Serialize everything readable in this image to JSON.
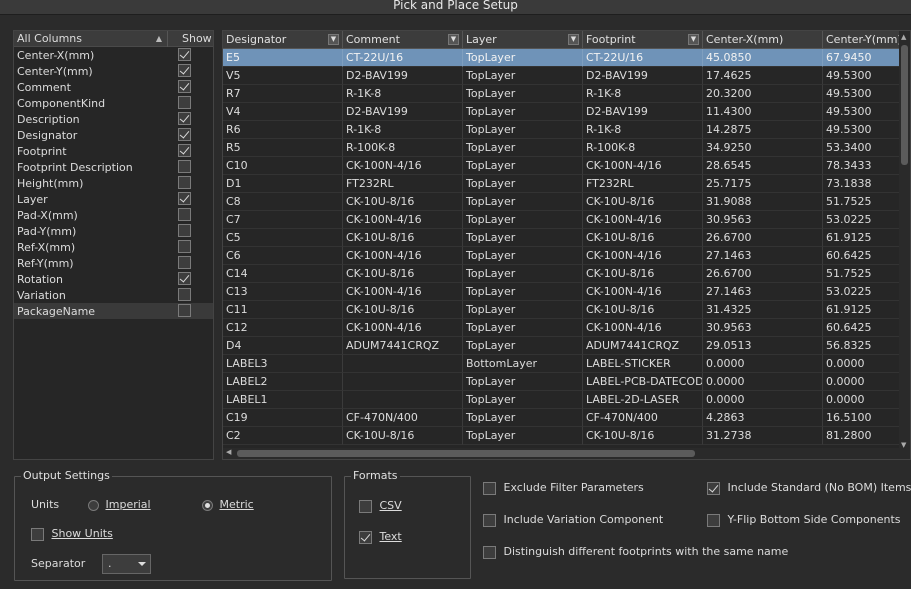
{
  "window": {
    "title": "Pick and Place Setup"
  },
  "columns_panel": {
    "header_label": "All Columns",
    "show_label": "Show",
    "items": [
      {
        "label": "Center-X(mm)",
        "show": true
      },
      {
        "label": "Center-Y(mm)",
        "show": true
      },
      {
        "label": "Comment",
        "show": true
      },
      {
        "label": "ComponentKind",
        "show": false
      },
      {
        "label": "Description",
        "show": true
      },
      {
        "label": "Designator",
        "show": true
      },
      {
        "label": "Footprint",
        "show": true
      },
      {
        "label": "Footprint Description",
        "show": false
      },
      {
        "label": "Height(mm)",
        "show": false
      },
      {
        "label": "Layer",
        "show": true
      },
      {
        "label": "Pad-X(mm)",
        "show": false
      },
      {
        "label": "Pad-Y(mm)",
        "show": false
      },
      {
        "label": "Ref-X(mm)",
        "show": false
      },
      {
        "label": "Ref-Y(mm)",
        "show": false
      },
      {
        "label": "Rotation",
        "show": true
      },
      {
        "label": "Variation",
        "show": false
      },
      {
        "label": "PackageName",
        "show": false
      }
    ]
  },
  "grid": {
    "headers": [
      "Designator",
      "Comment",
      "Layer",
      "Footprint",
      "Center-X(mm)",
      "Center-Y(mm)"
    ],
    "rows": [
      [
        "E5",
        "CT-22U/16",
        "TopLayer",
        "CT-22U/16",
        "45.0850",
        "67.9450"
      ],
      [
        "V5",
        "D2-BAV199",
        "TopLayer",
        "D2-BAV199",
        "17.4625",
        "49.5300"
      ],
      [
        "R7",
        "R-1K-8",
        "TopLayer",
        "R-1K-8",
        "20.3200",
        "49.5300"
      ],
      [
        "V4",
        "D2-BAV199",
        "TopLayer",
        "D2-BAV199",
        "11.4300",
        "49.5300"
      ],
      [
        "R6",
        "R-1K-8",
        "TopLayer",
        "R-1K-8",
        "14.2875",
        "49.5300"
      ],
      [
        "R5",
        "R-100K-8",
        "TopLayer",
        "R-100K-8",
        "34.9250",
        "53.3400"
      ],
      [
        "C10",
        "CK-100N-4/16",
        "TopLayer",
        "CK-100N-4/16",
        "28.6545",
        "78.3433"
      ],
      [
        "D1",
        "FT232RL",
        "TopLayer",
        "FT232RL",
        "25.7175",
        "73.1838"
      ],
      [
        "C8",
        "CK-10U-8/16",
        "TopLayer",
        "CK-10U-8/16",
        "31.9088",
        "51.7525"
      ],
      [
        "C7",
        "CK-100N-4/16",
        "TopLayer",
        "CK-100N-4/16",
        "30.9563",
        "53.0225"
      ],
      [
        "C5",
        "CK-10U-8/16",
        "TopLayer",
        "CK-10U-8/16",
        "26.6700",
        "61.9125"
      ],
      [
        "C6",
        "CK-100N-4/16",
        "TopLayer",
        "CK-100N-4/16",
        "27.1463",
        "60.6425"
      ],
      [
        "C14",
        "CK-10U-8/16",
        "TopLayer",
        "CK-10U-8/16",
        "26.6700",
        "51.7525"
      ],
      [
        "C13",
        "CK-100N-4/16",
        "TopLayer",
        "CK-100N-4/16",
        "27.1463",
        "53.0225"
      ],
      [
        "C11",
        "CK-10U-8/16",
        "TopLayer",
        "CK-10U-8/16",
        "31.4325",
        "61.9125"
      ],
      [
        "C12",
        "CK-100N-4/16",
        "TopLayer",
        "CK-100N-4/16",
        "30.9563",
        "60.6425"
      ],
      [
        "D4",
        "ADUM7441CRQZ",
        "TopLayer",
        "ADUM7441CRQZ",
        "29.0513",
        "56.8325"
      ],
      [
        "LABEL3",
        "",
        "BottomLayer",
        "LABEL-STICKER",
        "0.0000",
        "0.0000"
      ],
      [
        "LABEL2",
        "",
        "TopLayer",
        "LABEL-PCB-DATECODE",
        "0.0000",
        "0.0000"
      ],
      [
        "LABEL1",
        "",
        "TopLayer",
        "LABEL-2D-LASER",
        "0.0000",
        "0.0000"
      ],
      [
        "C19",
        "CF-470N/400",
        "TopLayer",
        "CF-470N/400",
        "4.2863",
        "16.5100"
      ],
      [
        "C2",
        "CK-10U-8/16",
        "TopLayer",
        "CK-10U-8/16",
        "31.2738",
        "81.2800"
      ]
    ]
  },
  "output_settings": {
    "legend": "Output Settings",
    "units_label": "Units",
    "imperial_label": "Imperial",
    "metric_label": "Metric",
    "units_selected": "Metric",
    "show_units_label": "Show Units",
    "show_units": false,
    "separator_label": "Separator",
    "separator_value": "."
  },
  "formats": {
    "legend": "Formats",
    "csv_label": "CSV",
    "csv": false,
    "text_label": "Text",
    "text": true
  },
  "options": {
    "exclude_filter_label": "Exclude Filter Parameters",
    "exclude_filter": false,
    "include_standard_label": "Include Standard (No BOM) Items",
    "include_standard": true,
    "include_variation_label": "Include Variation Component",
    "include_variation": false,
    "yflip_label": "Y-Flip Bottom Side Components",
    "yflip": false,
    "distinguish_label": "Distinguish different footprints with the same name",
    "distinguish": false
  }
}
